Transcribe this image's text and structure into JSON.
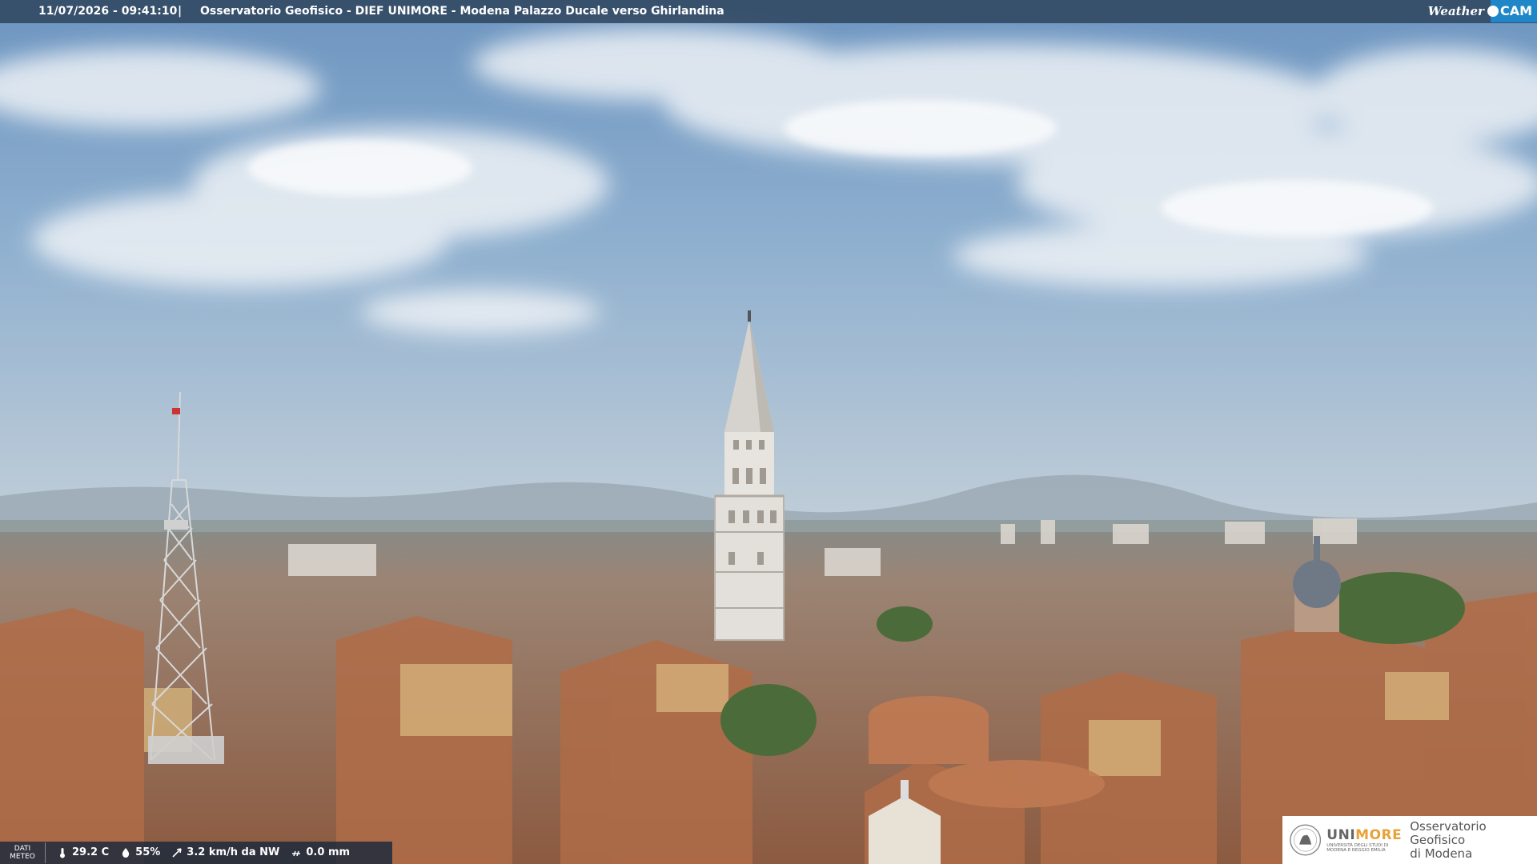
{
  "header": {
    "timestamp": "11/07/2026 - 09:41:10",
    "separator": "|",
    "title": "Osservatorio Geofisico - DIEF UNIMORE - Modena Palazzo Ducale verso Ghirlandina",
    "brand_word": "Weather",
    "brand_cam": "CAM"
  },
  "weather": {
    "label_line1": "DATI",
    "label_line2": "METEO",
    "temperature": "29.2 C",
    "humidity": "55%",
    "wind": "3.2 km/h da NW",
    "rain": "0.0 mm",
    "icons": [
      "thermometer-icon",
      "humidity-drop-icon",
      "wind-icon",
      "rain-icon"
    ]
  },
  "logo": {
    "uni_name_a": "UNI",
    "uni_name_b": "MORE",
    "uni_sub1": "UNIVERSITÀ DEGLI STUDI DI",
    "uni_sub2": "MODENA E REGGIO EMILIA",
    "obs_line1": "Osservatorio Geofisico",
    "obs_line2": "di Modena"
  },
  "colors": {
    "sky_top": "#6f96bf",
    "sky_horizon": "#b8c8d6",
    "roofs": "#a8694a",
    "unimore_accent": "#e8a23a",
    "weathercam_blue": "#1f86c8"
  }
}
